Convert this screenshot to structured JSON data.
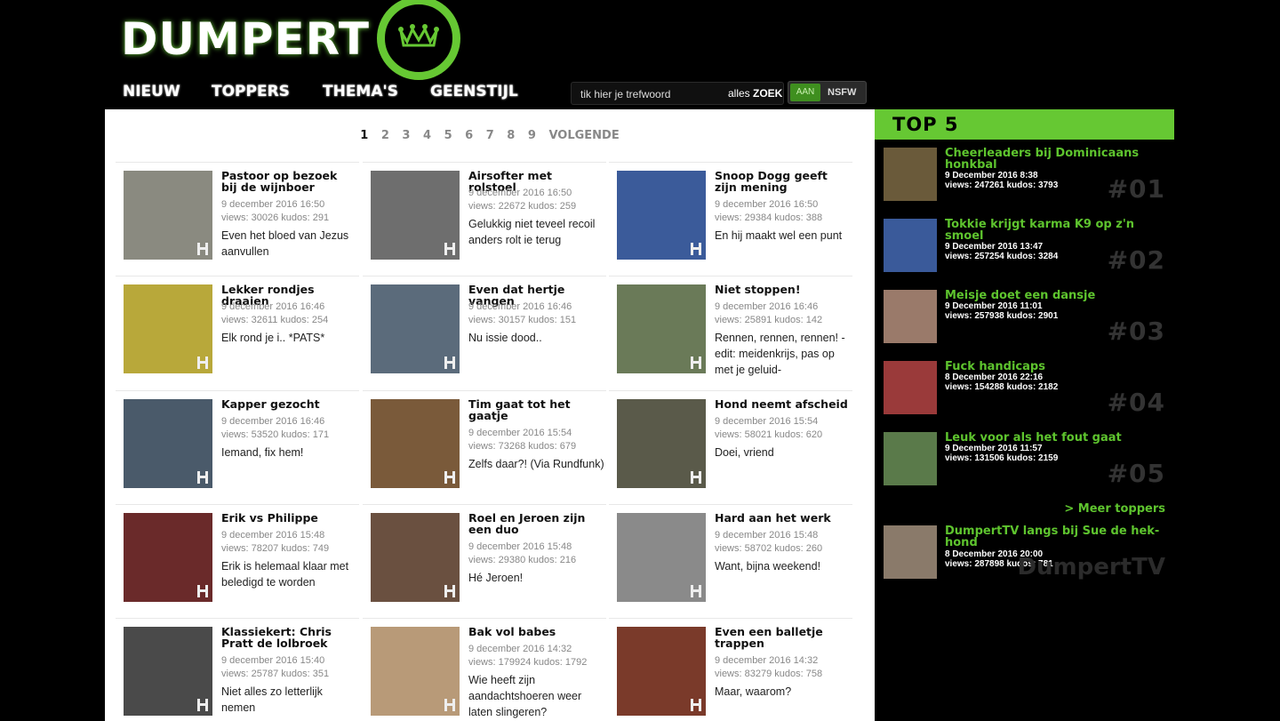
{
  "site": {
    "name": "DUMPERT"
  },
  "nav": {
    "items": [
      {
        "label": "NIEUW",
        "active": true
      },
      {
        "label": "TOPPERS",
        "active": false
      },
      {
        "label": "THEMA'S",
        "active": false
      },
      {
        "label": "GEENSTIJL",
        "active": false
      }
    ]
  },
  "search": {
    "placeholder": "tik hier je trefwoord",
    "scope": "alles",
    "button_label": "ZOEK"
  },
  "nsfw": {
    "on_label": "AAN",
    "label": "NSFW",
    "enabled": true
  },
  "pagination": {
    "pages": [
      "1",
      "2",
      "3",
      "4",
      "5",
      "6",
      "7",
      "8",
      "9"
    ],
    "current": "1",
    "next_label": "VOLGENDE"
  },
  "videos": [
    {
      "title": "Pastoor op bezoek bij de wijnboer",
      "date": "9 december 2016 16:50",
      "stats": "views: 30026 kudos: 291",
      "desc": "Even het bloed van Jezus aanvullen",
      "thumb_color": "#8a8a80"
    },
    {
      "title": "Airsofter met rolstoel",
      "date": "9 december 2016 16:50",
      "stats": "views: 22672 kudos: 259",
      "desc": "Gelukkig niet teveel recoil anders rolt ie terug",
      "thumb_color": "#6e6e6e"
    },
    {
      "title": "Snoop Dogg geeft zijn mening",
      "date": "9 december 2016 16:50",
      "stats": "views: 29384 kudos: 388",
      "desc": "En hij maakt wel een punt",
      "thumb_color": "#3b5b9a"
    },
    {
      "title": "Lekker rondjes draaien",
      "date": "9 december 2016 16:46",
      "stats": "views: 32611 kudos: 254",
      "desc": "Elk rond je i.. *PATS*",
      "thumb_color": "#b8a83a"
    },
    {
      "title": "Even dat hertje vangen",
      "date": "9 december 2016 16:46",
      "stats": "views: 30157 kudos: 151",
      "desc": "Nu issie dood..",
      "thumb_color": "#5b6b7b"
    },
    {
      "title": "Niet stoppen!",
      "date": "9 december 2016 16:46",
      "stats": "views: 25891 kudos: 142",
      "desc": "Rennen, rennen, rennen! -edit: meidenkrijs, pas op met je geluid-",
      "thumb_color": "#6a7a58"
    },
    {
      "title": "Kapper gezocht",
      "date": "9 december 2016 16:46",
      "stats": "views: 53520 kudos: 171",
      "desc": "Iemand, fix hem!",
      "thumb_color": "#4a5a6a"
    },
    {
      "title": "Tim gaat tot het gaatje",
      "date": "9 december 2016 15:54",
      "stats": "views: 73268 kudos: 679",
      "desc": "Zelfs daar?! (Via Rundfunk)",
      "thumb_color": "#7a5a3a"
    },
    {
      "title": "Hond neemt afscheid",
      "date": "9 december 2016 15:54",
      "stats": "views: 58021 kudos: 620",
      "desc": "Doei, vriend",
      "thumb_color": "#5a5a4a"
    },
    {
      "title": "Erik vs Philippe",
      "date": "9 december 2016 15:48",
      "stats": "views: 78207 kudos: 749",
      "desc": "Erik is helemaal klaar met beledigd te worden",
      "thumb_color": "#6a2a2a"
    },
    {
      "title": "Roel en Jeroen zijn een duo",
      "date": "9 december 2016 15:48",
      "stats": "views: 29380 kudos: 216",
      "desc": "Hé Jeroen!",
      "thumb_color": "#6a5040"
    },
    {
      "title": "Hard aan het werk",
      "date": "9 december 2016 15:48",
      "stats": "views: 58702 kudos: 260",
      "desc": "Want, bijna weekend!",
      "thumb_color": "#8a8a8a"
    },
    {
      "title": "Klassiekert: Chris Pratt de lolbroek",
      "date": "9 december 2016 15:40",
      "stats": "views: 25787 kudos: 351",
      "desc": "Niet alles zo letterlijk nemen",
      "thumb_color": "#4a4a4a"
    },
    {
      "title": "Bak vol babes",
      "date": "9 december 2016 14:32",
      "stats": "views: 179924 kudos: 1792",
      "desc": "Wie heeft zijn aandachtshoeren weer laten slingeren?",
      "thumb_color": "#b89a78"
    },
    {
      "title": "Even een balletje trappen",
      "date": "9 december 2016 14:32",
      "stats": "views: 83279 kudos: 758",
      "desc": "Maar, waarom?",
      "thumb_color": "#7a3a2a"
    }
  ],
  "top5": {
    "title": "TOP 5",
    "items": [
      {
        "title": "Cheerleaders bij Dominicaans honkbal",
        "date": "9 December 2016 8:38",
        "stats": "views: 247261 kudos: 3793",
        "rank": "#01",
        "thumb_color": "#6a5a3a"
      },
      {
        "title": "Tokkie krijgt karma K9 op z'n smoel",
        "date": "9 December 2016 13:47",
        "stats": "views: 257254 kudos: 3284",
        "rank": "#02",
        "thumb_color": "#3a5a9a"
      },
      {
        "title": "Meisje doet een dansje",
        "date": "9 December 2016 11:01",
        "stats": "views: 257938 kudos: 2901",
        "rank": "#03",
        "thumb_color": "#9a7a6a"
      },
      {
        "title": "Fuck handicaps",
        "date": "8 December 2016 22:16",
        "stats": "views: 154288 kudos: 2182",
        "rank": "#04",
        "thumb_color": "#9a3a3a"
      },
      {
        "title": "Leuk voor als het fout gaat",
        "date": "9 December 2016 11:57",
        "stats": "views: 131506 kudos: 2159",
        "rank": "#05",
        "thumb_color": "#5a7a4a"
      }
    ],
    "more_label": "> Meer toppers"
  },
  "dumpert_tv": {
    "title": "DumpertTV langs bij Sue de hek-hond",
    "date": "8 December 2016 20:00",
    "stats": "views: 287898 kudos: 781",
    "label": "DumpertTV",
    "thumb_color": "#8a7a6a"
  }
}
